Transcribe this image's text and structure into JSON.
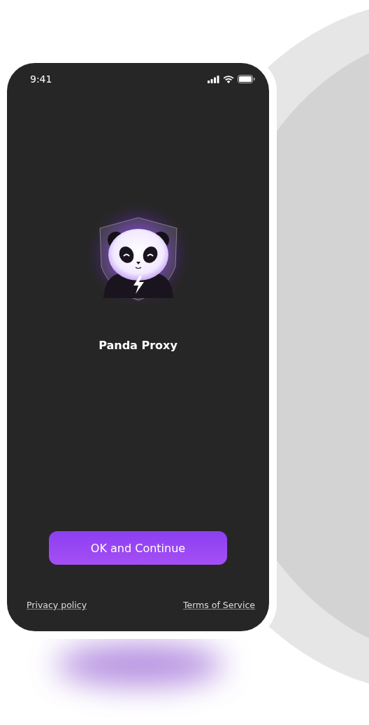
{
  "status_bar": {
    "time": "9:41"
  },
  "app": {
    "name": "Panda Proxy"
  },
  "primary_button": {
    "label": "OK and Continue"
  },
  "footer_links": [
    {
      "label": "Privacy policy"
    },
    {
      "label": "Terms of Service"
    }
  ]
}
